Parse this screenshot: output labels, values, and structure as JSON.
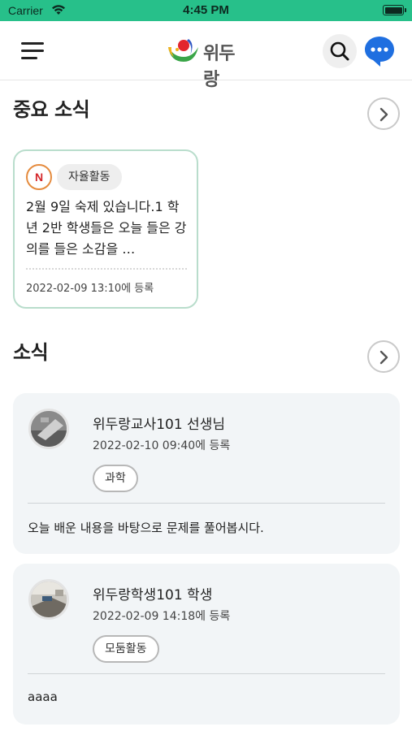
{
  "status_bar": {
    "carrier": "Carrier",
    "time": "4:45 PM"
  },
  "header": {
    "logo_text": "위두랑",
    "icons": [
      "menu-icon",
      "search-icon",
      "chat-icon"
    ]
  },
  "important_news": {
    "title": "중요 소식",
    "cards": [
      {
        "badge": "N",
        "category": "자율활동",
        "text": "2월 9일 숙제 있습니다.1 학년 2반 학생들은 오늘 들은 강의를 들은 소감을 …",
        "date": "2022-02-09 13:10에 등록"
      }
    ]
  },
  "news": {
    "title": "소식",
    "posts": [
      {
        "author": "위두랑교사101 선생님",
        "date": "2022-02-10 09:40에 등록",
        "tag": "과학",
        "body": "오늘 배운 내용을 바탕으로 문제를 풀어봅시다."
      },
      {
        "author": "위두랑학생101 학생",
        "date": "2022-02-09 14:18에 등록",
        "tag": "모둠활동",
        "body": "aaaa"
      }
    ]
  },
  "colors": {
    "status_bar": "#27c08a",
    "chat_button": "#1f6fe0",
    "card_border": "#b9ddcc",
    "feed_bg": "#f2f5f7"
  }
}
